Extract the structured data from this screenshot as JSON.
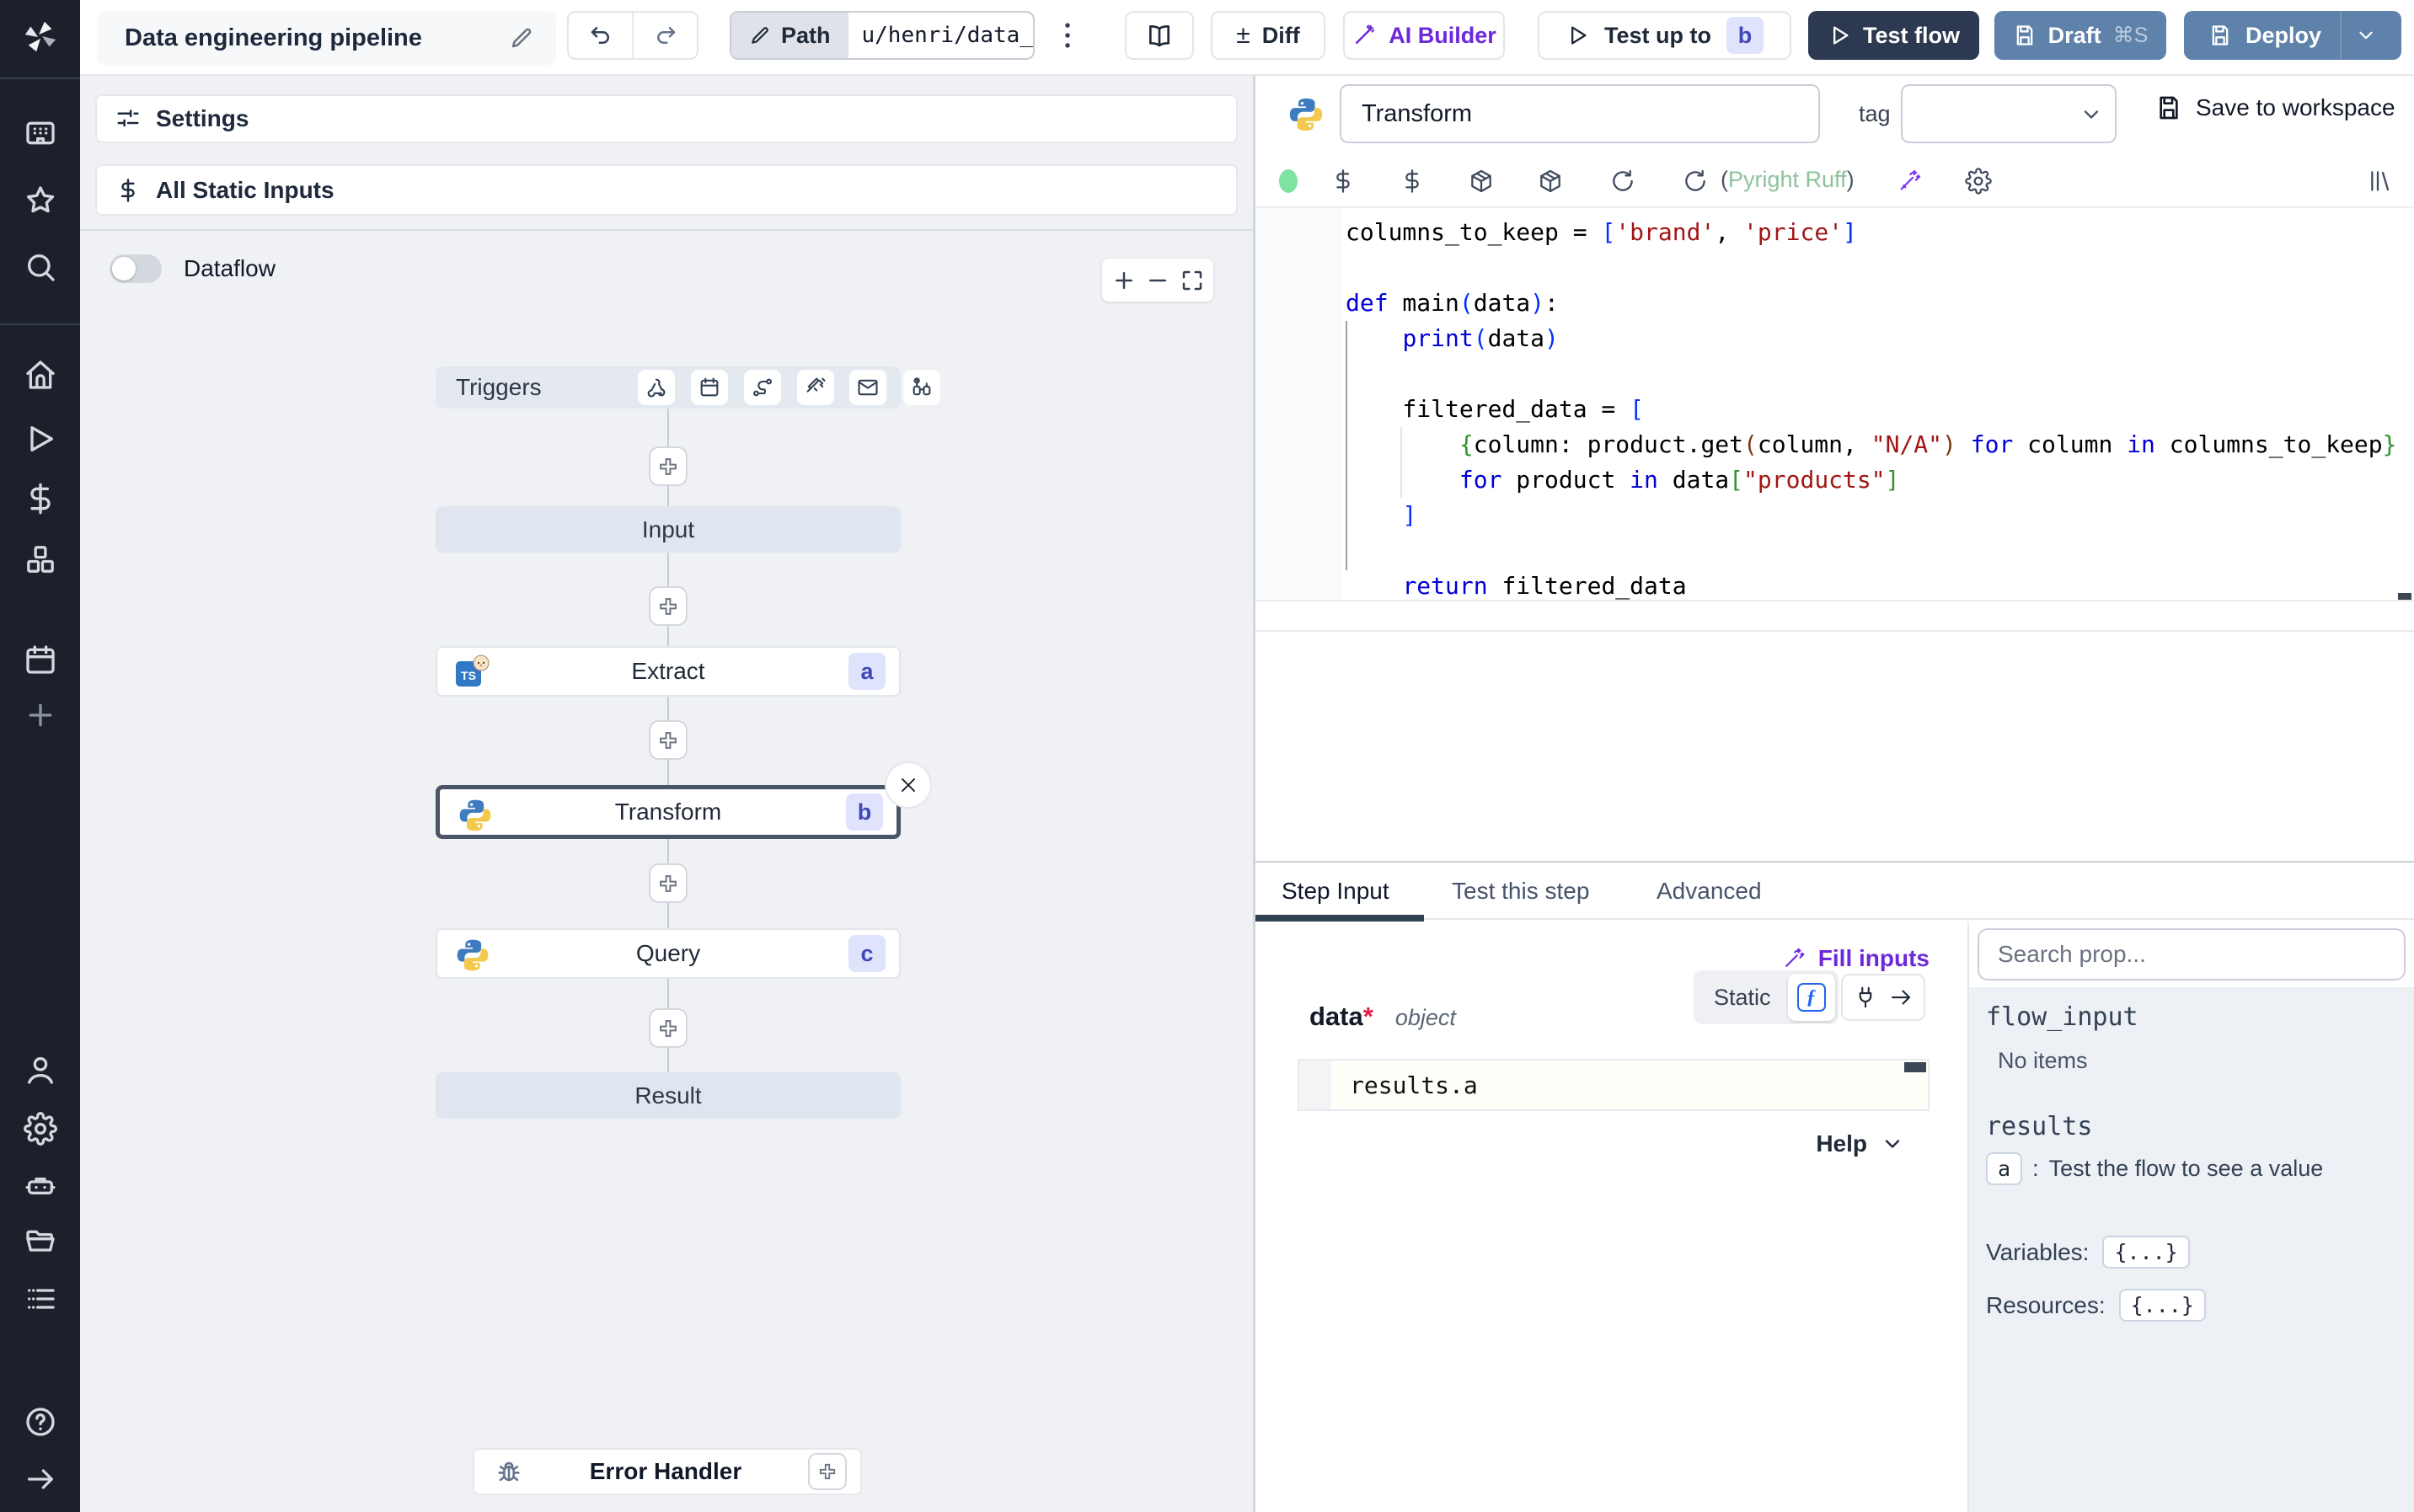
{
  "topbar": {
    "title": "Data engineering pipeline",
    "path_label": "Path",
    "path_value": "u/henri/data_",
    "diff_label": "Diff",
    "ai_builder_label": "AI Builder",
    "test_up_to_label": "Test up to",
    "test_up_to_badge": "b",
    "test_flow_label": "Test flow",
    "draft_label": "Draft",
    "draft_shortcut": "⌘S",
    "deploy_label": "Deploy"
  },
  "left_panel": {
    "settings_label": "Settings",
    "all_static_inputs_label": "All Static Inputs",
    "dataflow_label": "Dataflow",
    "triggers_label": "Triggers",
    "trigger_icons": [
      "webhook",
      "schedule",
      "route",
      "kafka",
      "email",
      "poll"
    ],
    "input_label": "Input",
    "result_label": "Result",
    "error_handler_label": "Error Handler",
    "steps": [
      {
        "label": "Extract",
        "badge": "a",
        "lang": "typescript-bun"
      },
      {
        "label": "Transform",
        "badge": "b",
        "lang": "python",
        "selected": true
      },
      {
        "label": "Query",
        "badge": "c",
        "lang": "python"
      }
    ]
  },
  "rail_icons": [
    "windmill-logo",
    "workspace",
    "star",
    "search",
    "home",
    "runs",
    "variables",
    "resources",
    "schedules",
    "add",
    "user",
    "settings",
    "workers",
    "folders",
    "logs",
    "help",
    "expand"
  ],
  "editor": {
    "step_name": "Transform",
    "tag_label": "tag",
    "save_label": "Save to workspace",
    "lint_open": "(",
    "lint_text": "Pyright Ruff",
    "lint_close": ")",
    "code": [
      [
        [
          "p",
          "columns_to_keep = "
        ],
        [
          "b1",
          "["
        ],
        [
          "s",
          "'brand'"
        ],
        [
          "p",
          ", "
        ],
        [
          "s",
          "'price'"
        ],
        [
          "b1",
          "]"
        ]
      ],
      [],
      [
        [
          "k",
          "def"
        ],
        [
          "p",
          " main"
        ],
        [
          "b1",
          "("
        ],
        [
          "p",
          "data"
        ],
        [
          "b1",
          ")"
        ],
        [
          "p",
          ":"
        ]
      ],
      [
        [
          "p",
          "    "
        ],
        [
          "k",
          "print"
        ],
        [
          "b1",
          "("
        ],
        [
          "p",
          "data"
        ],
        [
          "b1",
          ")"
        ]
      ],
      [],
      [
        [
          "p",
          "    filtered_data = "
        ],
        [
          "b1",
          "["
        ]
      ],
      [
        [
          "p",
          "        "
        ],
        [
          "b2",
          "{"
        ],
        [
          "p",
          "column: product.get"
        ],
        [
          "b3",
          "("
        ],
        [
          "p",
          "column, "
        ],
        [
          "s",
          "\"N/A\""
        ],
        [
          "b3",
          ")"
        ],
        [
          "p",
          " "
        ],
        [
          "k",
          "for"
        ],
        [
          "p",
          " column "
        ],
        [
          "k",
          "in"
        ],
        [
          "p",
          " columns_to_keep"
        ],
        [
          "b2",
          "}"
        ]
      ],
      [
        [
          "p",
          "        "
        ],
        [
          "k",
          "for"
        ],
        [
          "p",
          " product "
        ],
        [
          "k",
          "in"
        ],
        [
          "p",
          " data"
        ],
        [
          "b2",
          "["
        ],
        [
          "s",
          "\"products\""
        ],
        [
          "b2",
          "]"
        ]
      ],
      [
        [
          "p",
          "    "
        ],
        [
          "b1",
          "]"
        ]
      ],
      [],
      [
        [
          "p",
          "    "
        ],
        [
          "k",
          "return"
        ],
        [
          "p",
          " filtered_data"
        ]
      ]
    ]
  },
  "bottom": {
    "tabs": [
      "Step Input",
      "Test this step",
      "Advanced"
    ],
    "fill_inputs_label": "Fill inputs",
    "field_name": "data",
    "field_required": "*",
    "field_type": "object",
    "static_label": "Static",
    "expression": "results.a",
    "help_label": "Help",
    "search_placeholder": "Search prop...",
    "props": {
      "flow_input_label": "flow_input",
      "no_items": "No items",
      "results_label": "results",
      "result_key": "a",
      "result_sep": ":",
      "result_hint": "Test the flow to see a value",
      "variables_label": "Variables:",
      "variables_value": "{...}",
      "resources_label": "Resources:",
      "resources_value": "{...}"
    }
  },
  "colors": {
    "accent_purple": "#6d28d9",
    "dark_button": "#2c3950",
    "steel_button": "#5e82aa",
    "badge_bg": "#dfe3fc",
    "badge_text": "#4149b8",
    "lint_green": "#8cc39b",
    "status_green": "#6ee7a0"
  }
}
